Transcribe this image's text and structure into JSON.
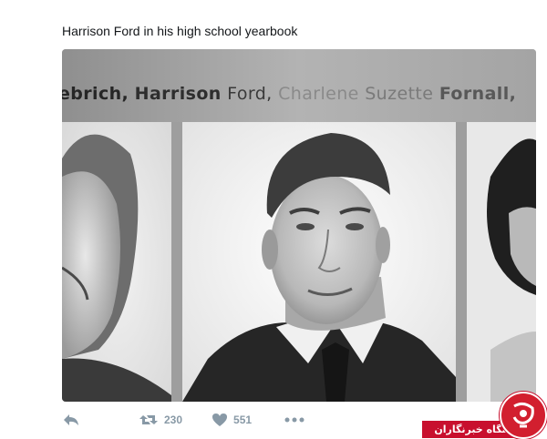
{
  "tweet": {
    "text": "Harrison Ford in his high school yearbook"
  },
  "yearbook_photo": {
    "name_line": {
      "part1": "ebrich,",
      "part2": "Harrison",
      "part3": "Ford,",
      "part4": "Charlene",
      "part5": "Suzette",
      "part6": "Fornall,"
    }
  },
  "actions": {
    "reply_icon": "reply-icon",
    "retweet_icon": "retweet-icon",
    "retweet_count": "230",
    "like_icon": "heart-icon",
    "like_count": "551",
    "more_icon": "more-dots-icon"
  },
  "watermark": {
    "text": "باشگاه خبرنگاران",
    "color": "#c8102e"
  },
  "colors": {
    "text": "#14171a",
    "action_gray": "#8899a6"
  }
}
